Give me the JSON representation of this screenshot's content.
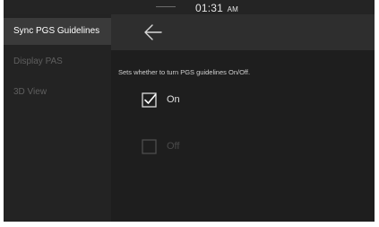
{
  "status_bar": {
    "time": "01:31",
    "ampm": "AM"
  },
  "sidebar": {
    "items": [
      {
        "label": "Sync PGS Guidelines",
        "active": true
      },
      {
        "label": "Display PAS",
        "active": false
      },
      {
        "label": "3D View",
        "active": false
      }
    ]
  },
  "header": {
    "back_icon": "arrow-left-icon"
  },
  "content": {
    "description": "Sets whether to turn PGS guidelines On/Off.",
    "options": [
      {
        "label": "On",
        "checked": true,
        "enabled": true
      },
      {
        "label": "Off",
        "checked": false,
        "enabled": false
      }
    ]
  },
  "colors": {
    "background": "#1c1c1c",
    "sidebar_active": "#3a3a3a",
    "text_active": "#ffffff",
    "text_dim": "#5f5f5f"
  }
}
